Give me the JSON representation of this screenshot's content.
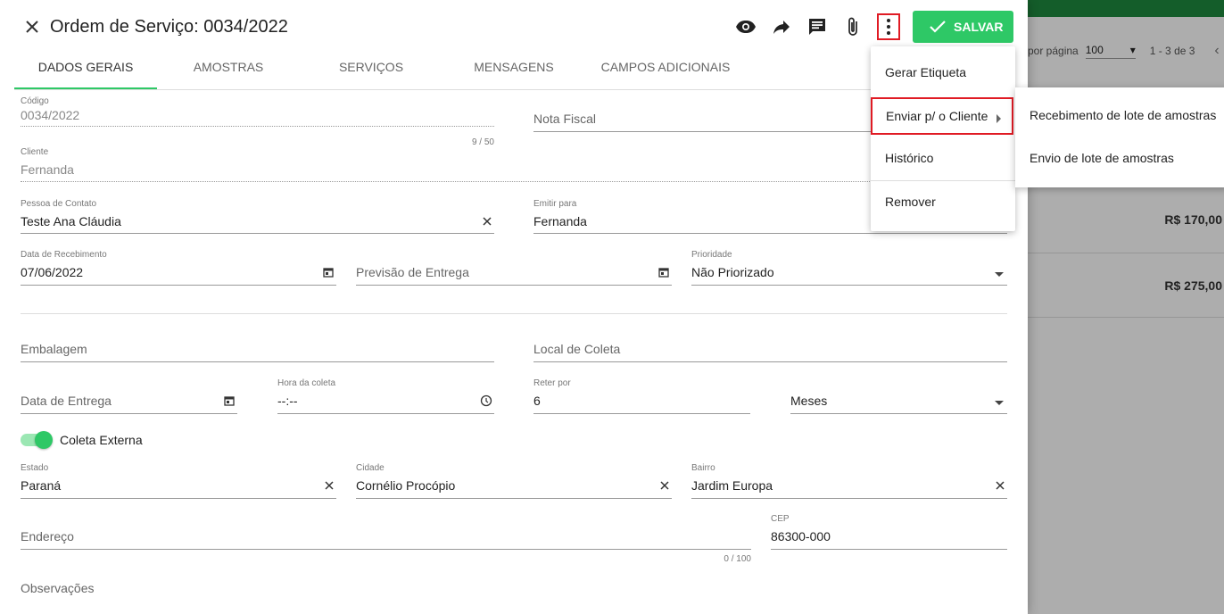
{
  "background": {
    "per_page_label": "por página",
    "per_page_value": "100",
    "range": "1 - 3 de 3",
    "rows": [
      "R$ 170,00",
      "R$ 275,00"
    ]
  },
  "header": {
    "title": "Ordem de Serviço: 0034/2022",
    "save_label": "SALVAR",
    "icons": [
      "close-icon",
      "eye-icon",
      "share-arrow-icon",
      "comment-icon",
      "attachment-icon",
      "more-vert-icon",
      "check-icon"
    ]
  },
  "tabs": [
    {
      "label": "DADOS GERAIS",
      "active": true
    },
    {
      "label": "AMOSTRAS"
    },
    {
      "label": "SERVIÇOS"
    },
    {
      "label": "MENSAGENS"
    },
    {
      "label": "CAMPOS ADICIONAIS"
    }
  ],
  "form": {
    "codigo": {
      "label": "Código",
      "value": "0034/2022",
      "counter": "9 / 50"
    },
    "nota_fiscal": {
      "placeholder": "Nota Fiscal"
    },
    "cliente": {
      "label": "Cliente",
      "value": "Fernanda"
    },
    "pessoa_contato": {
      "label": "Pessoa de Contato",
      "value": "Teste Ana Cláudia"
    },
    "emitir_para": {
      "label": "Emitir para",
      "value": "Fernanda"
    },
    "data_recebimento": {
      "label": "Data de Recebimento",
      "value": "07/06/2022"
    },
    "previsao_entrega": {
      "placeholder": "Previsão de Entrega"
    },
    "prioridade": {
      "label": "Prioridade",
      "value": "Não Priorizado"
    },
    "embalagem": {
      "placeholder": "Embalagem"
    },
    "local_coleta": {
      "placeholder": "Local de Coleta"
    },
    "data_entrega": {
      "placeholder": "Data de Entrega"
    },
    "hora_coleta": {
      "label": "Hora da coleta",
      "value": "--:--"
    },
    "reter_por": {
      "label": "Reter por",
      "value": "6"
    },
    "reter_unidade": {
      "value": "Meses"
    },
    "coleta_externa": {
      "label": "Coleta Externa",
      "on": true
    },
    "estado": {
      "label": "Estado",
      "value": "Paraná"
    },
    "cidade": {
      "label": "Cidade",
      "value": "Cornélio Procópio"
    },
    "bairro": {
      "label": "Bairro",
      "value": "Jardim Europa"
    },
    "endereco": {
      "placeholder": "Endereço",
      "counter": "0 / 100"
    },
    "cep": {
      "label": "CEP",
      "value": "86300-000"
    },
    "observacoes": {
      "placeholder": "Observações"
    }
  },
  "menu": {
    "items": [
      "Gerar Etiqueta",
      "Enviar p/ o Cliente",
      "Histórico",
      "Remover"
    ]
  },
  "submenu": {
    "items": [
      "Recebimento de lote de amostras",
      "Envio de lote de amostras"
    ]
  },
  "colors": {
    "accent": "#2ec866",
    "highlight": "#e01b24"
  }
}
